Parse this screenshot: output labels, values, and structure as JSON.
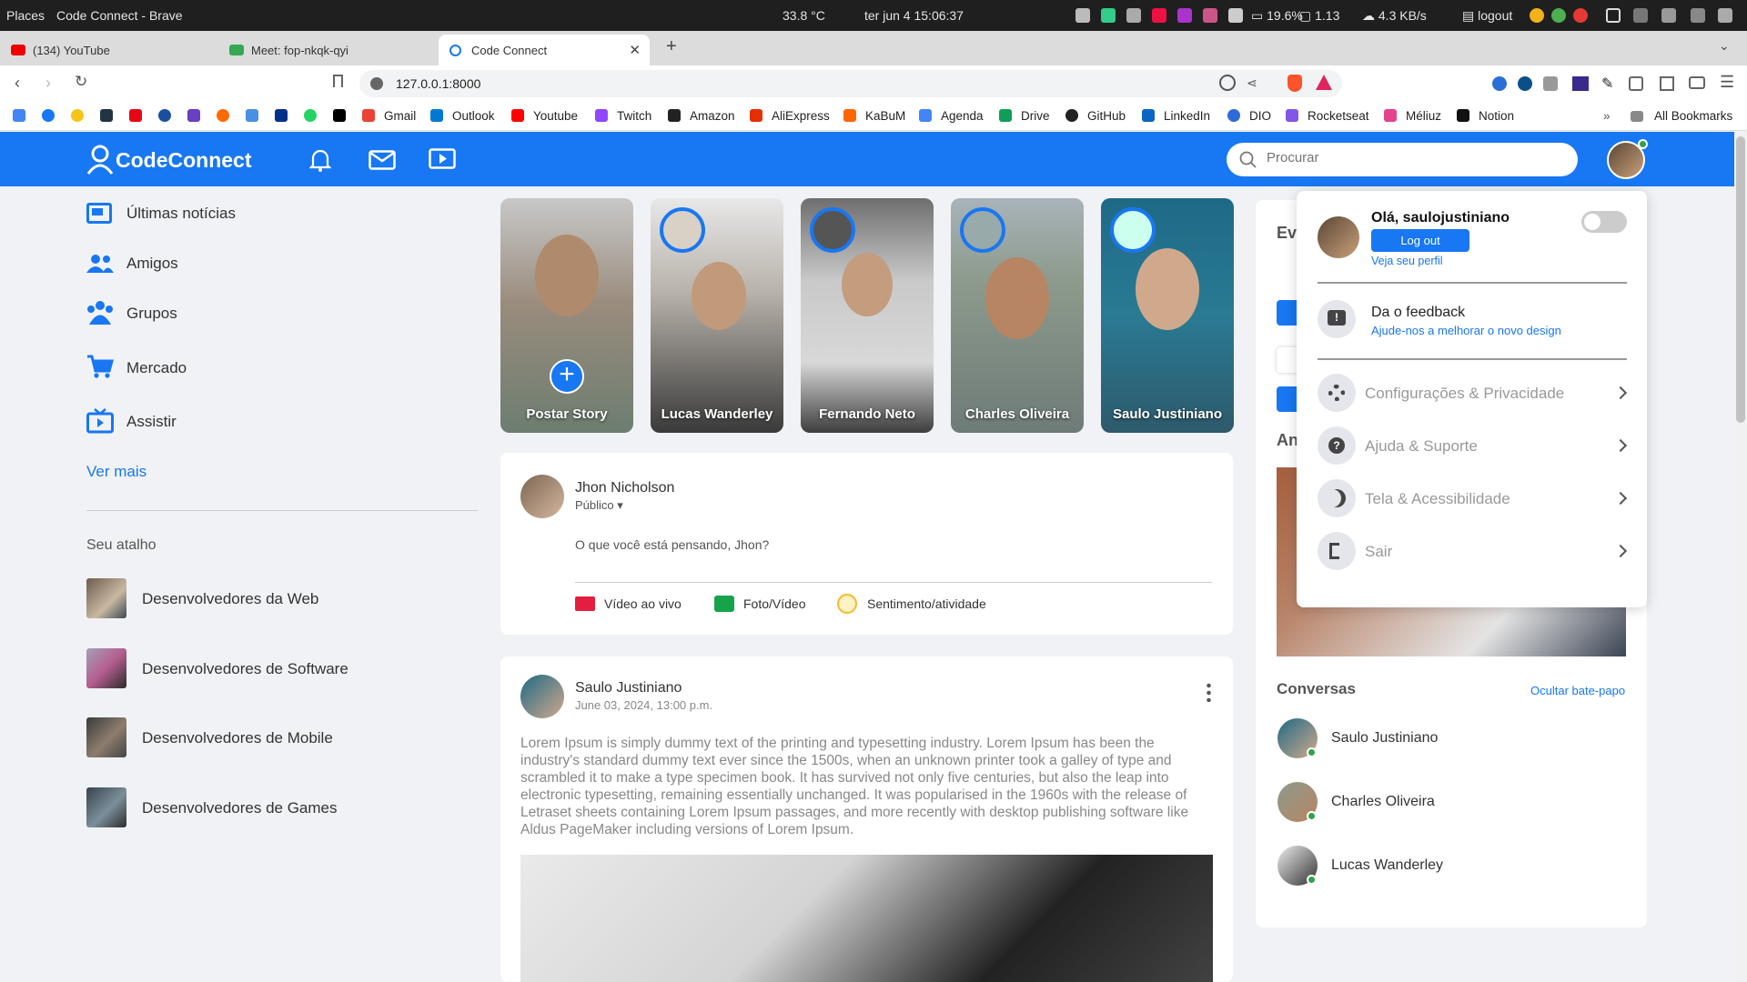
{
  "os_panel": {
    "places": "Places",
    "window_title": "Code Connect - Brave",
    "temp": "33.8 °C",
    "datetime": "ter jun 4  15:06:37",
    "battery": "19.6%",
    "load": "1.13",
    "net": "4.3 KB/s",
    "session": "logout"
  },
  "tabs": [
    {
      "title": "(134) YouTube"
    },
    {
      "title": "Meet: fop-nkqk-qyi"
    },
    {
      "title": "Code Connect"
    }
  ],
  "url": "127.0.0.1:8000",
  "bookmarks": [
    "Gmail",
    "Outlook",
    "Youtube",
    "Twitch",
    "Amazon",
    "AliExpress",
    "KaBuM",
    "Agenda",
    "Drive",
    "GitHub",
    "LinkedIn",
    "DIO",
    "Rocketseat",
    "Méliuz",
    "Notion"
  ],
  "all_bookmarks": "All Bookmarks",
  "app": {
    "brand": "CodeConnect",
    "search_placeholder": "Procurar"
  },
  "sidebar": {
    "items": [
      {
        "label": "Últimas notícias"
      },
      {
        "label": "Amigos"
      },
      {
        "label": "Grupos"
      },
      {
        "label": "Mercado"
      },
      {
        "label": "Assistir"
      }
    ],
    "more": "Ver mais",
    "shortcuts_title": "Seu atalho",
    "shortcuts": [
      {
        "label": "Desenvolvedores da Web"
      },
      {
        "label": "Desenvolvedores de Software"
      },
      {
        "label": "Desenvolvedores de Mobile"
      },
      {
        "label": "Desenvolvedores de Games"
      }
    ]
  },
  "stories": [
    {
      "name": "Postar Story"
    },
    {
      "name": "Lucas Wanderley"
    },
    {
      "name": "Fernando Neto"
    },
    {
      "name": "Charles Oliveira"
    },
    {
      "name": "Saulo Justiniano"
    }
  ],
  "composer": {
    "user": "Jhon Nicholson",
    "privacy": "Público",
    "placeholder": "O que você está pensando, Jhon?",
    "actions": [
      "Vídeo ao vivo",
      "Foto/Vídeo",
      "Sentimento/atividade"
    ]
  },
  "post": {
    "author": "Saulo Justiniano",
    "date": "June 03, 2024, 13:00 p.m.",
    "text": "Lorem Ipsum is simply dummy text of the printing and typesetting industry. Lorem Ipsum has been the industry's standard dummy text ever since the 1500s, when an unknown printer took a galley of type and scrambled it to make a type specimen book. It has survived not only five centuries, but also the leap into electronic typesetting, remaining essentially unchanged. It was popularised in the 1960s with the release of Letraset sheets containing Lorem Ipsum passages, and more recently with desktop publishing software like Aldus PageMaker including versions of Lorem Ipsum."
  },
  "right": {
    "events_title": "Ev",
    "ads_title": "An",
    "chat_title": "Conversas",
    "hide_chat": "Ocultar bate-papo",
    "contacts": [
      {
        "name": "Saulo Justiniano"
      },
      {
        "name": "Charles Oliveira"
      },
      {
        "name": "Lucas Wanderley"
      }
    ]
  },
  "dropdown": {
    "greeting": "Olá, saulojustiniano",
    "logout_button": "Log out",
    "profile_link": "Veja seu perfil",
    "feedback_title": "Da o feedback",
    "feedback_sub": "Ajude-nos a melhorar o novo design",
    "items": [
      {
        "label": "Configurações & Privacidade"
      },
      {
        "label": "Ajuda & Suporte"
      },
      {
        "label": "Tela & Acessibilidade"
      },
      {
        "label": "Sair"
      }
    ]
  },
  "colors": {
    "primary": "#1877f2",
    "header": "#1877f2",
    "online": "#31a24c"
  }
}
